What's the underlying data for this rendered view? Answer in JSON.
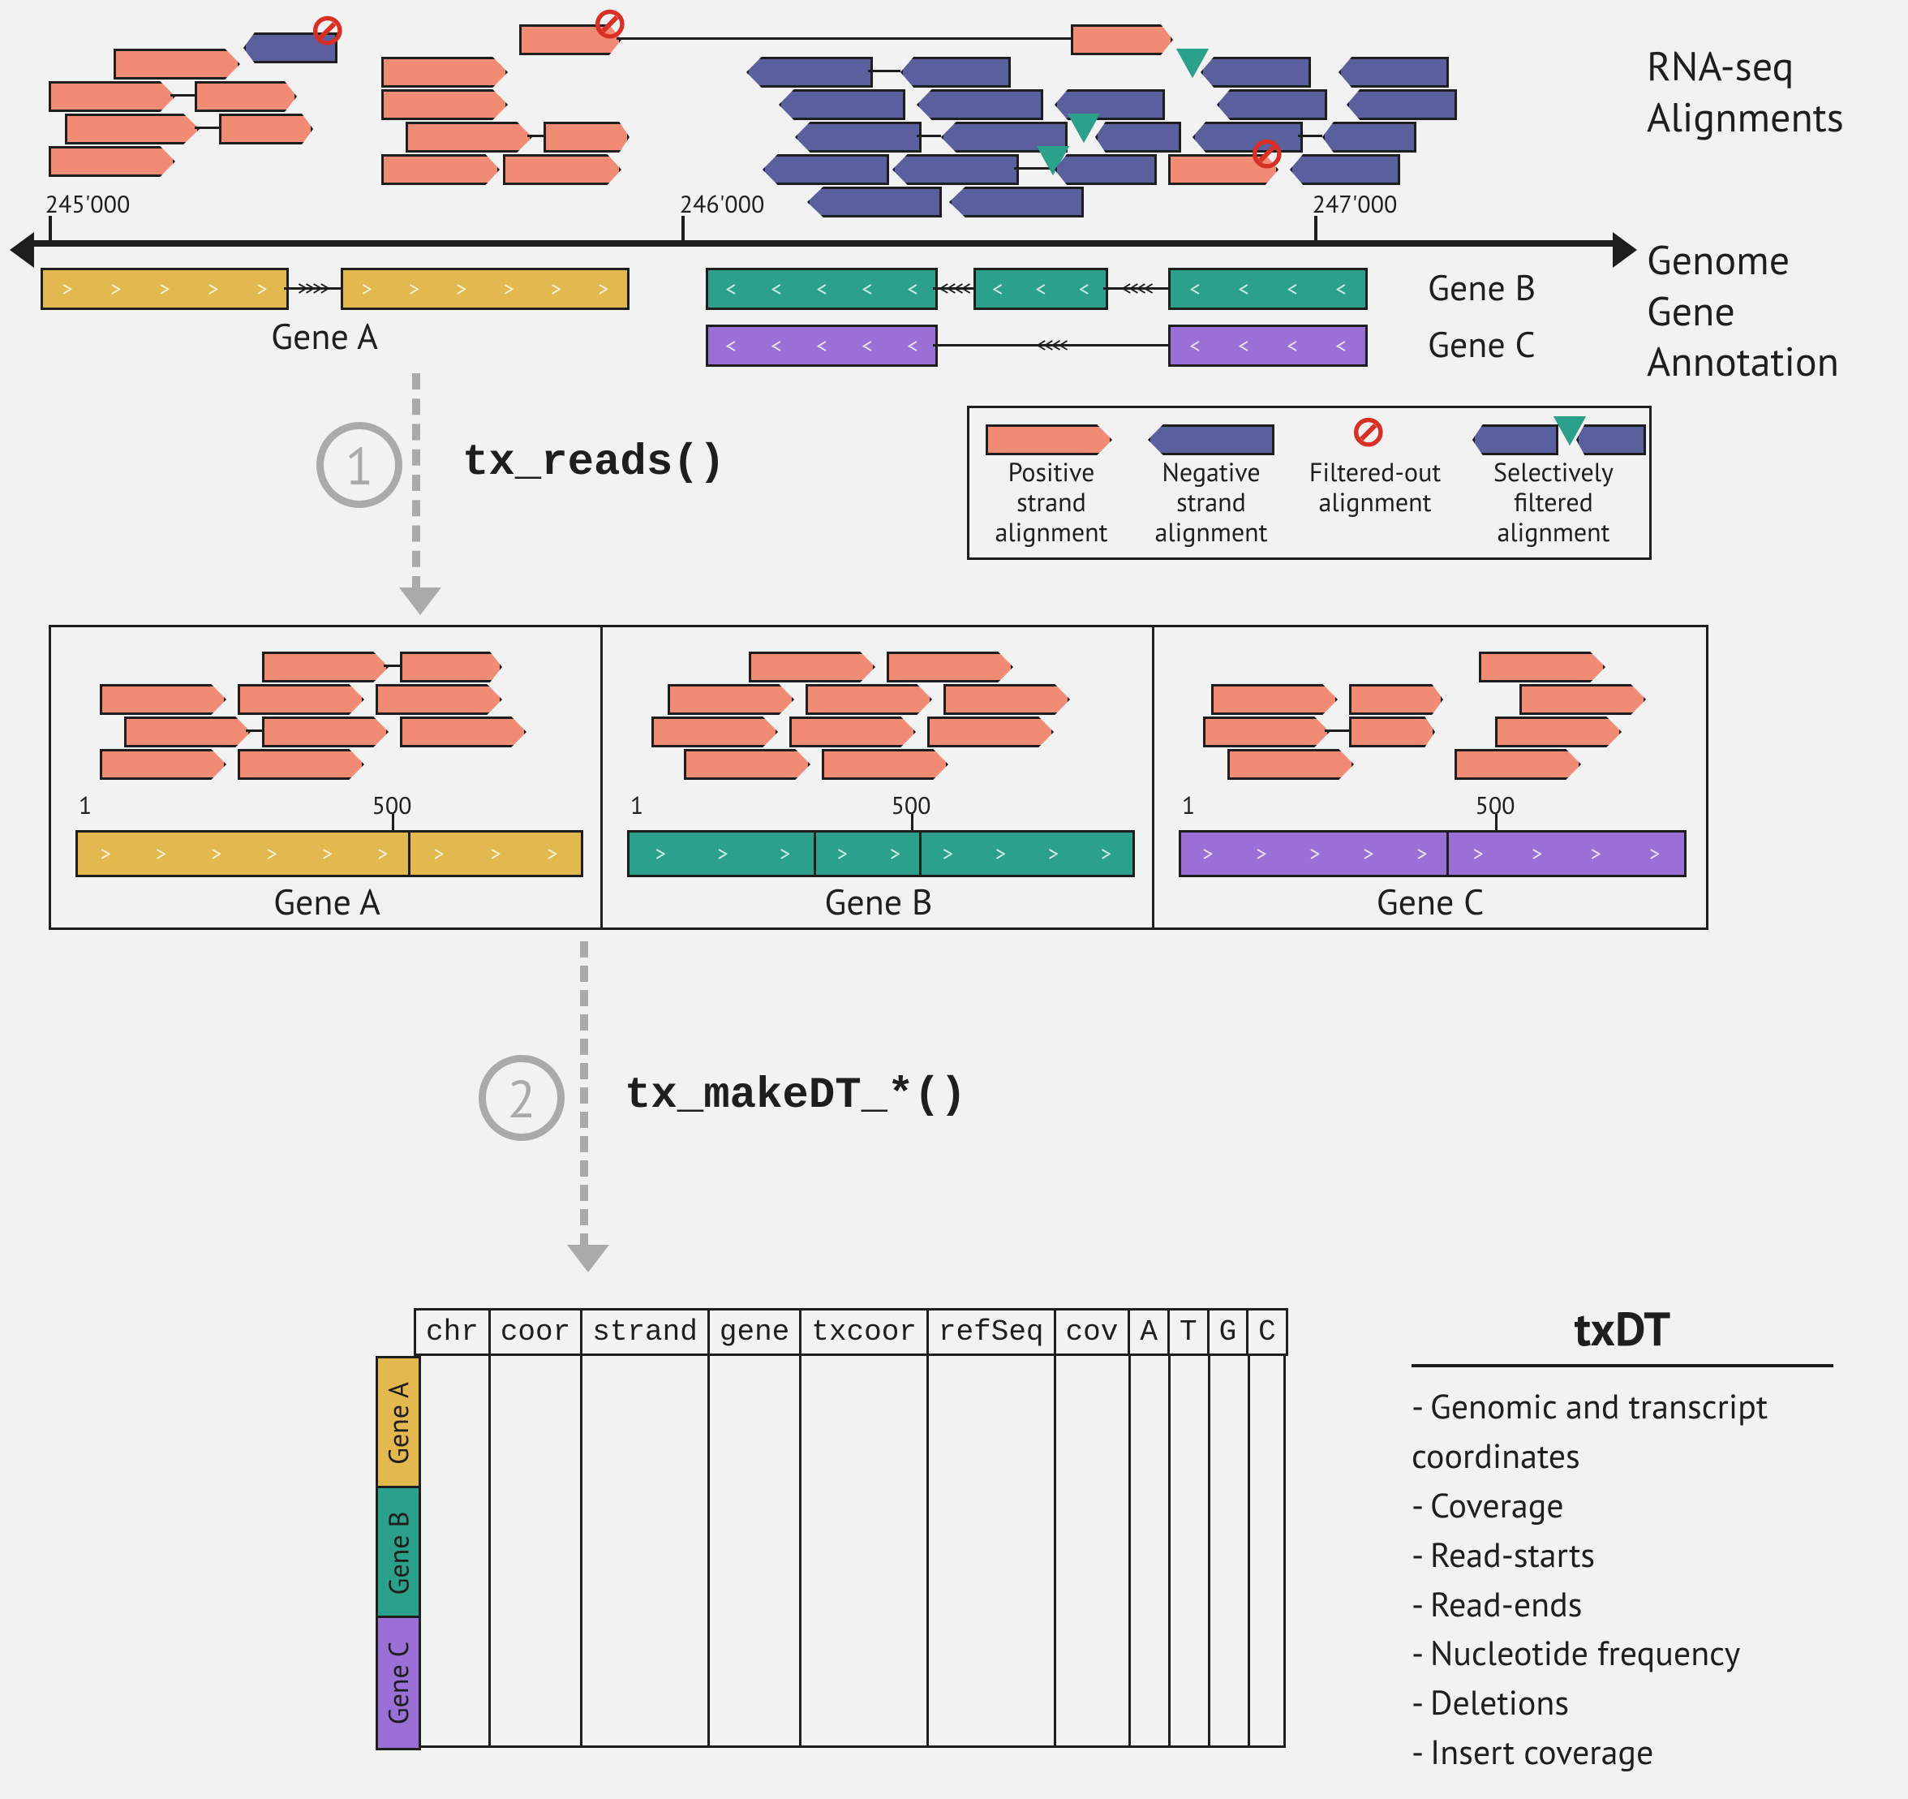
{
  "right_labels": {
    "l1": "RNA-seq",
    "l2": "Alignments",
    "l3": "Genome",
    "l4": "Gene",
    "l5": "Annotation"
  },
  "axis": {
    "ticks": [
      "245'000",
      "246'000",
      "247'000"
    ]
  },
  "genes": {
    "a": "Gene A",
    "b": "Gene B",
    "c": "Gene C"
  },
  "legend": {
    "pos": "Positive strand\nalignment",
    "neg": "Negative strand\nalignment",
    "filt": "Filtered-out\nalignment",
    "sel": "Selectively\nfiltered\nalignment"
  },
  "steps": {
    "n1": "1",
    "n2": "2",
    "fn1": "tx_reads()",
    "fn2": "tx_makeDT_*()"
  },
  "panels": {
    "t1": "1",
    "t500": "500"
  },
  "table": {
    "headers": [
      "chr",
      "coor",
      "strand",
      "gene",
      "txcoor",
      "refSeq",
      "cov",
      "A",
      "T",
      "G",
      "C"
    ]
  },
  "txdt": {
    "title": "txDT",
    "items": [
      "Genomic and transcript coordinates",
      "Coverage",
      "Read-starts",
      "Read-ends",
      "Nucleotide frequency",
      "Deletions",
      "Insert coverage"
    ]
  }
}
